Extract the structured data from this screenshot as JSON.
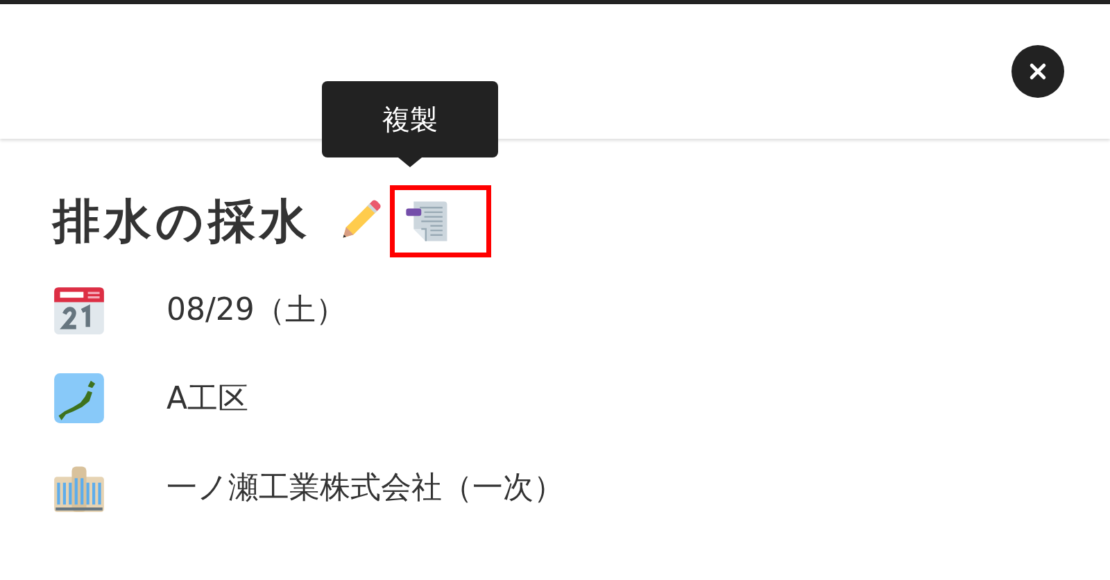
{
  "title": "排水の採水",
  "tooltip": {
    "text": "複製"
  },
  "copy_button": {
    "highlighted": true
  },
  "details": [
    {
      "kind": "calendar",
      "text": "08/29（土）"
    },
    {
      "kind": "map",
      "text": "A工区"
    },
    {
      "kind": "building",
      "text": "一ノ瀬工業株式会社（一次）"
    }
  ]
}
